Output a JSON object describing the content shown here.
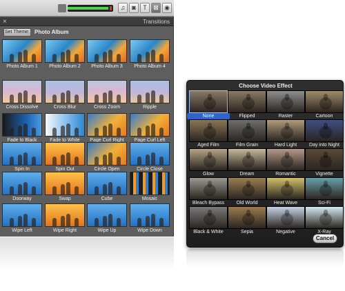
{
  "transitions_panel": {
    "title": "Transitions",
    "close_symbol": "×",
    "set_theme_label": "Set Theme:",
    "theme_name": "Photo Album",
    "volume_level_percent": 90,
    "toolbar_buttons": [
      {
        "icon": "music-icon",
        "glyph": "♫"
      },
      {
        "icon": "camera-icon",
        "glyph": "◙"
      },
      {
        "icon": "title-icon",
        "glyph": "T"
      },
      {
        "icon": "transitions-icon",
        "glyph": "⊠"
      },
      {
        "icon": "maps-icon",
        "glyph": "◉"
      }
    ],
    "items": [
      {
        "label": "Photo Album 1",
        "style": "album"
      },
      {
        "label": "Photo Album 2",
        "style": "album"
      },
      {
        "label": "Photo Album 3",
        "style": "album"
      },
      {
        "label": "Photo Album 4",
        "style": "album"
      },
      {
        "label": "Cross Dissolve",
        "style": "soft"
      },
      {
        "label": "Cross Blur",
        "style": "soft2"
      },
      {
        "label": "Cross Zoom",
        "style": "soft"
      },
      {
        "label": "Ripple",
        "style": "soft2"
      },
      {
        "label": "Fade to Black",
        "style": "black"
      },
      {
        "label": "Fade to White",
        "style": "white"
      },
      {
        "label": "Page Curl Right",
        "style": "curl"
      },
      {
        "label": "Page Curl Left",
        "style": "curl"
      },
      {
        "label": "Spin In",
        "style": "blue"
      },
      {
        "label": "Spin Out",
        "style": "orange"
      },
      {
        "label": "Circle Open",
        "style": "curl"
      },
      {
        "label": "Circle Close",
        "style": "blue"
      },
      {
        "label": "Doorway",
        "style": "blue"
      },
      {
        "label": "Swap",
        "style": "orange"
      },
      {
        "label": "Cube",
        "style": "blue"
      },
      {
        "label": "Mosaic",
        "style": "mosaic"
      },
      {
        "label": "Wipe Left",
        "style": "blue"
      },
      {
        "label": "Wipe Right",
        "style": "orange"
      },
      {
        "label": "Wipe Up",
        "style": "blue"
      },
      {
        "label": "Wipe Down",
        "style": "blue"
      }
    ]
  },
  "effect_dialog": {
    "title": "Choose Video Effect",
    "cancel_label": "Cancel",
    "selected": "None",
    "effects": [
      {
        "label": "None",
        "tint": "#8a7a66"
      },
      {
        "label": "Flipped",
        "tint": "#8a7a66"
      },
      {
        "label": "Raster",
        "tint": "#8e8e8e"
      },
      {
        "label": "Cartoon",
        "tint": "#a08c6a"
      },
      {
        "label": "Aged Film",
        "tint": "#8a7656"
      },
      {
        "label": "Film Grain",
        "tint": "#6e6e6e"
      },
      {
        "label": "Hard Light",
        "tint": "#b09a7a"
      },
      {
        "label": "Day into Night",
        "tint": "#3e4f82"
      },
      {
        "label": "Glow",
        "tint": "#b5a488"
      },
      {
        "label": "Dream",
        "tint": "#c6b89a"
      },
      {
        "label": "Romantic",
        "tint": "#b49a8a"
      },
      {
        "label": "Vignette",
        "tint": "#5a4a38"
      },
      {
        "label": "Bleach Bypass",
        "tint": "#9a9a92"
      },
      {
        "label": "Old World",
        "tint": "#9a7e52"
      },
      {
        "label": "Heat Wave",
        "tint": "#d0c06a"
      },
      {
        "label": "Sci-Fi",
        "tint": "#6aa0a8"
      },
      {
        "label": "Black & White",
        "tint": "#7a7a7a"
      },
      {
        "label": "Sepia",
        "tint": "#9c7b50"
      },
      {
        "label": "Negative",
        "tint": "#c6d2e2"
      },
      {
        "label": "X-Ray",
        "tint": "#d6e8f0"
      }
    ]
  }
}
